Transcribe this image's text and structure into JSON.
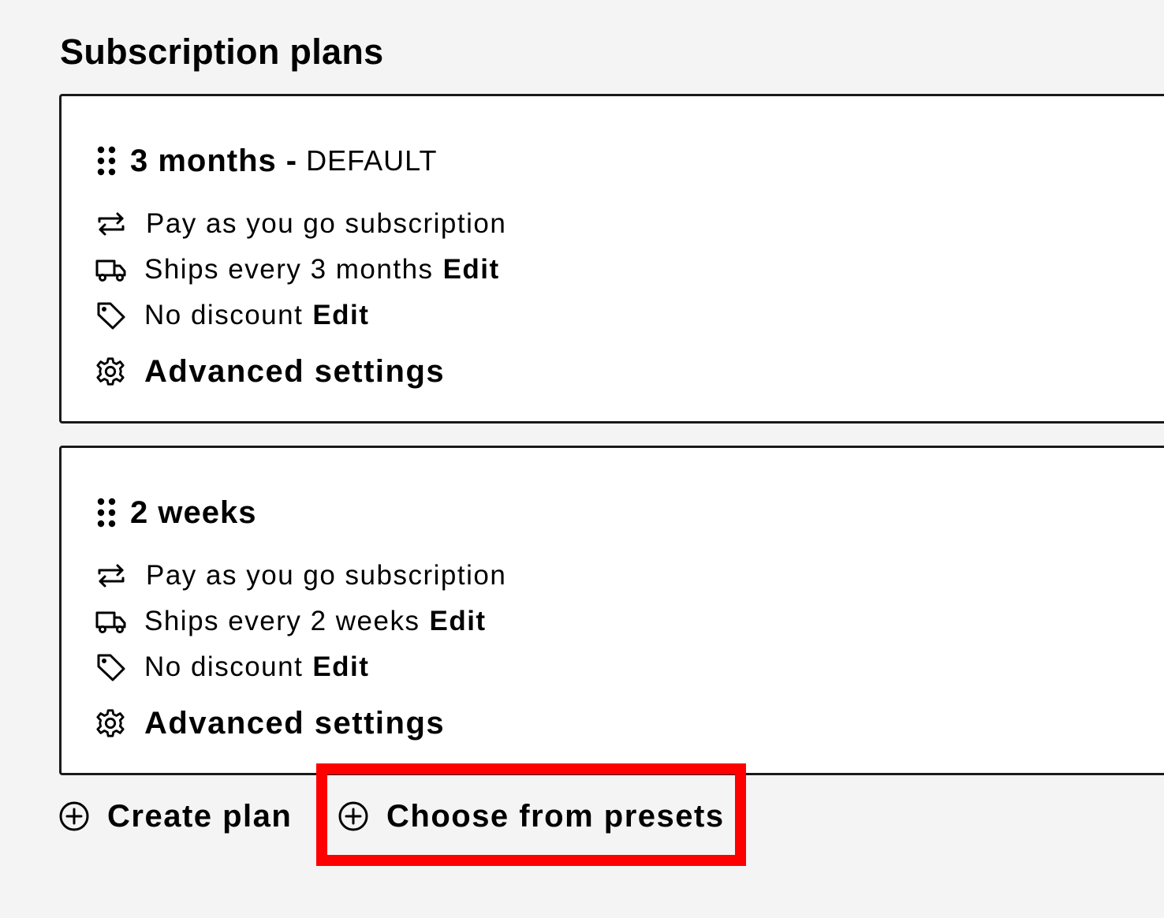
{
  "page": {
    "title": "Subscription plans"
  },
  "plans": [
    {
      "name": "3 months",
      "separator": "-",
      "badge": "DEFAULT",
      "payment": "Pay as you go subscription",
      "shipping": "Ships every 3 months",
      "shipping_edit": "Edit",
      "discount": "No discount",
      "discount_edit": "Edit",
      "advanced": "Advanced settings"
    },
    {
      "name": "2 weeks",
      "payment": "Pay as you go subscription",
      "shipping": "Ships every 2 weeks",
      "shipping_edit": "Edit",
      "discount": "No discount",
      "discount_edit": "Edit",
      "advanced": "Advanced settings"
    }
  ],
  "actions": {
    "create_plan": "Create plan",
    "choose_presets": "Choose from presets"
  },
  "icons": {
    "drag": "drag-handle-icon",
    "repeat": "repeat-icon",
    "truck": "truck-icon",
    "tag": "tag-icon",
    "gear": "gear-icon",
    "plus_circle": "plus-circle-icon"
  },
  "colors": {
    "background": "#f4f4f4",
    "card": "#ffffff",
    "border": "#1a1a1a",
    "highlight": "#ff0000"
  }
}
